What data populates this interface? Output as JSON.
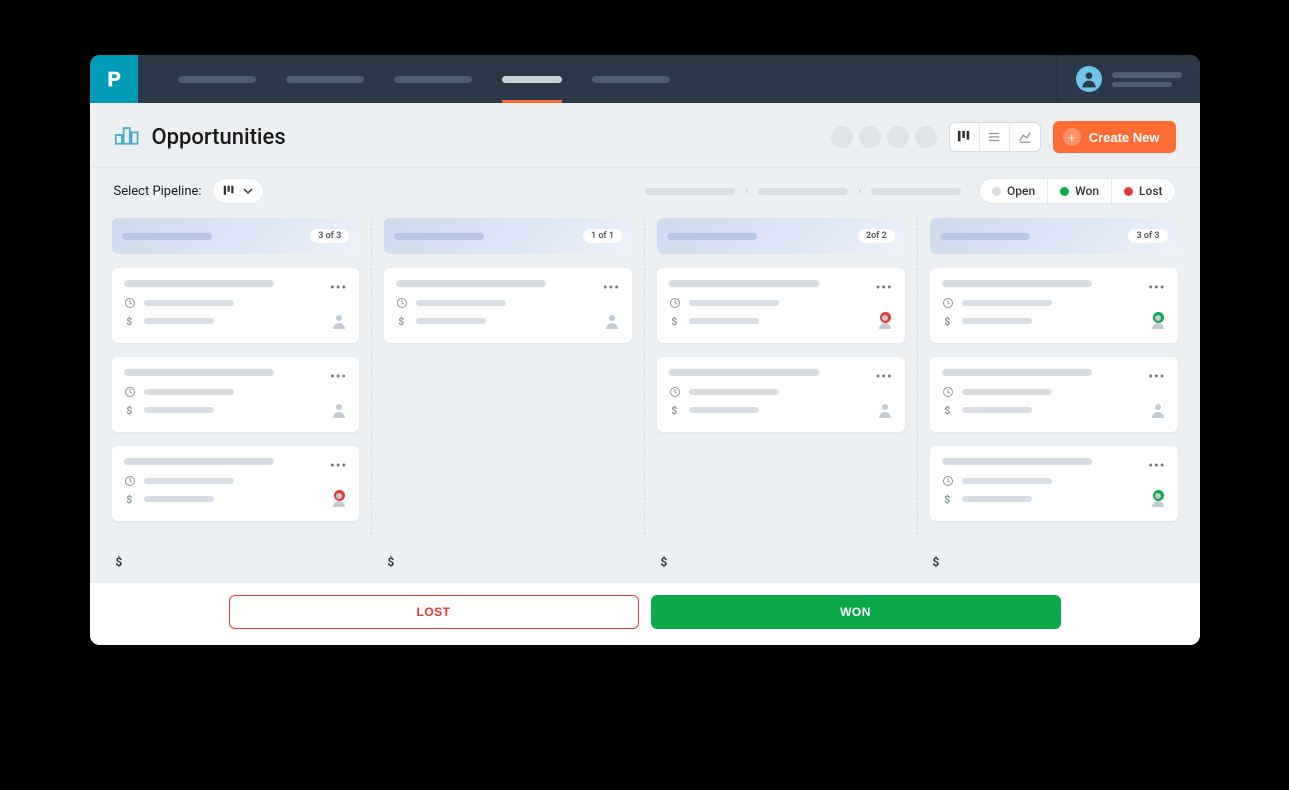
{
  "page": {
    "title": "Opportunities",
    "create_button": "Create New"
  },
  "filters": {
    "select_label": "Select Pipeline:"
  },
  "status_chips": {
    "open": "Open",
    "won": "Won",
    "lost": "Lost"
  },
  "colors": {
    "accent": "#ff6b35",
    "won": "#0ba84a",
    "lost": "#e53935",
    "open": "#d7dde3"
  },
  "columns": [
    {
      "count": "3 of 3",
      "cards": [
        {
          "status": null
        },
        {
          "status": null
        },
        {
          "status": "lost"
        }
      ]
    },
    {
      "count": "1 of 1",
      "cards": [
        {
          "status": null
        }
      ]
    },
    {
      "count": "2of 2",
      "cards": [
        {
          "status": "lost"
        },
        {
          "status": null
        }
      ]
    },
    {
      "count": "3 of 3",
      "cards": [
        {
          "status": "won"
        },
        {
          "status": null
        },
        {
          "status": "won"
        }
      ]
    }
  ],
  "footer": {
    "lost": "LOST",
    "won": "WON"
  }
}
